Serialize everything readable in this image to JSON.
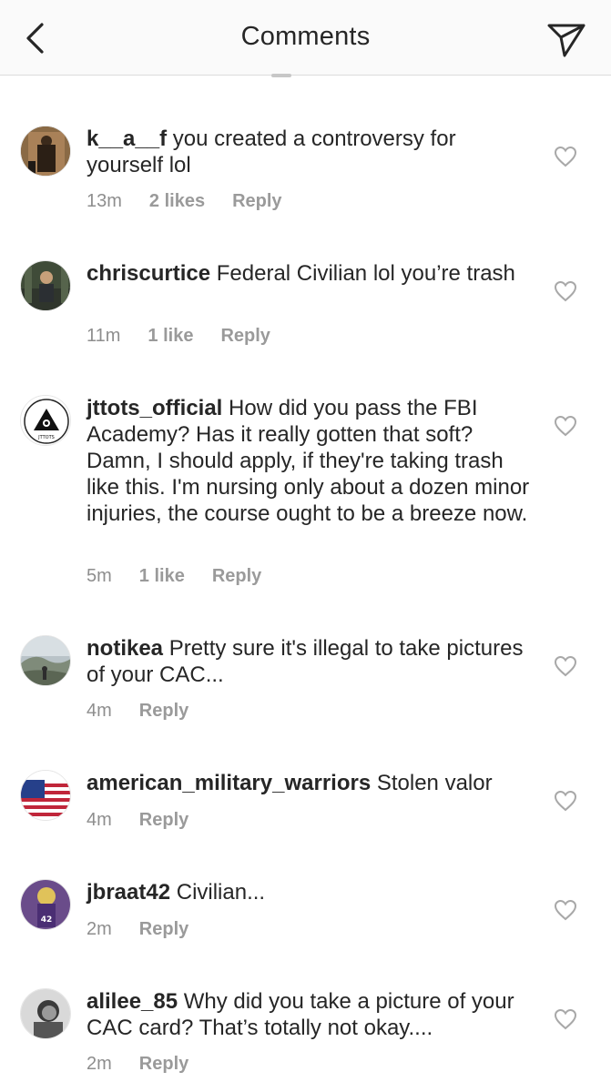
{
  "header": {
    "title": "Comments",
    "back_icon": "chevron-left-icon",
    "share_icon": "paper-plane-icon"
  },
  "comments": [
    {
      "username": "k__a__f",
      "text": " you created a controversy for yourself lol",
      "time": "13m",
      "likes": "2 likes",
      "reply": "Reply"
    },
    {
      "username": "chriscurtice",
      "text": " Federal Civilian lol you’re trash",
      "time": "11m",
      "likes": "1 like",
      "reply": "Reply"
    },
    {
      "username": "jttots_official",
      "text": " How did you pass the FBI Academy?  Has it really gotten that soft? Damn, I should apply, if they're taking trash like this.  I'm nursing only about a dozen minor injuries, the course ought to be a breeze now.",
      "time": "5m",
      "likes": "1 like",
      "reply": "Reply",
      "avatar_text": "JTTOTS"
    },
    {
      "username": "notikea",
      "text": " Pretty sure it's illegal to take pictures of your CAC...",
      "time": "4m",
      "reply": "Reply"
    },
    {
      "username": "american_military_warriors",
      "text": " Stolen valor",
      "time": "4m",
      "reply": "Reply"
    },
    {
      "username": "jbraat42",
      "text": " Civilian...",
      "time": "2m",
      "reply": "Reply"
    },
    {
      "username": "alilee_85",
      "text": " Why did you take a picture of your CAC card? That’s totally not okay....",
      "time": "2m",
      "reply": "Reply"
    }
  ],
  "colors": {
    "text": "#262626",
    "meta": "#8e8e8e",
    "header_bg": "#fafafa",
    "divider": "#dbdbdb"
  }
}
